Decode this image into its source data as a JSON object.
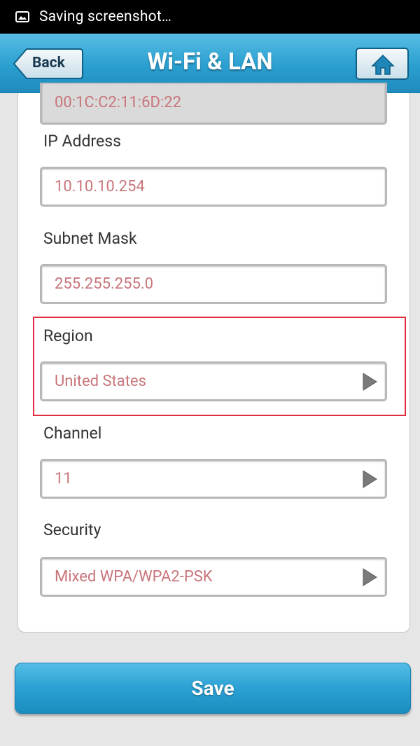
{
  "status_bar": {
    "text": "Saving screenshot…",
    "icon": "screenshot-icon"
  },
  "nav": {
    "back_label": "Back",
    "title": "Wi-Fi & LAN",
    "home_icon": "home-icon"
  },
  "fields": {
    "mac": {
      "value": "00:1C:C2:11:6D:22"
    },
    "ip": {
      "label": "IP Address",
      "value": "10.10.10.254"
    },
    "subnet": {
      "label": "Subnet Mask",
      "value": "255.255.255.0"
    },
    "region": {
      "label": "Region",
      "value": "United States"
    },
    "channel": {
      "label": "Channel",
      "value": "11"
    },
    "security": {
      "label": "Security",
      "value": "Mixed WPA/WPA2-PSK"
    }
  },
  "save_label": "Save",
  "colors": {
    "accent": "#2aa0d3",
    "value_text": "#c8757a",
    "highlight": "#e03040"
  }
}
